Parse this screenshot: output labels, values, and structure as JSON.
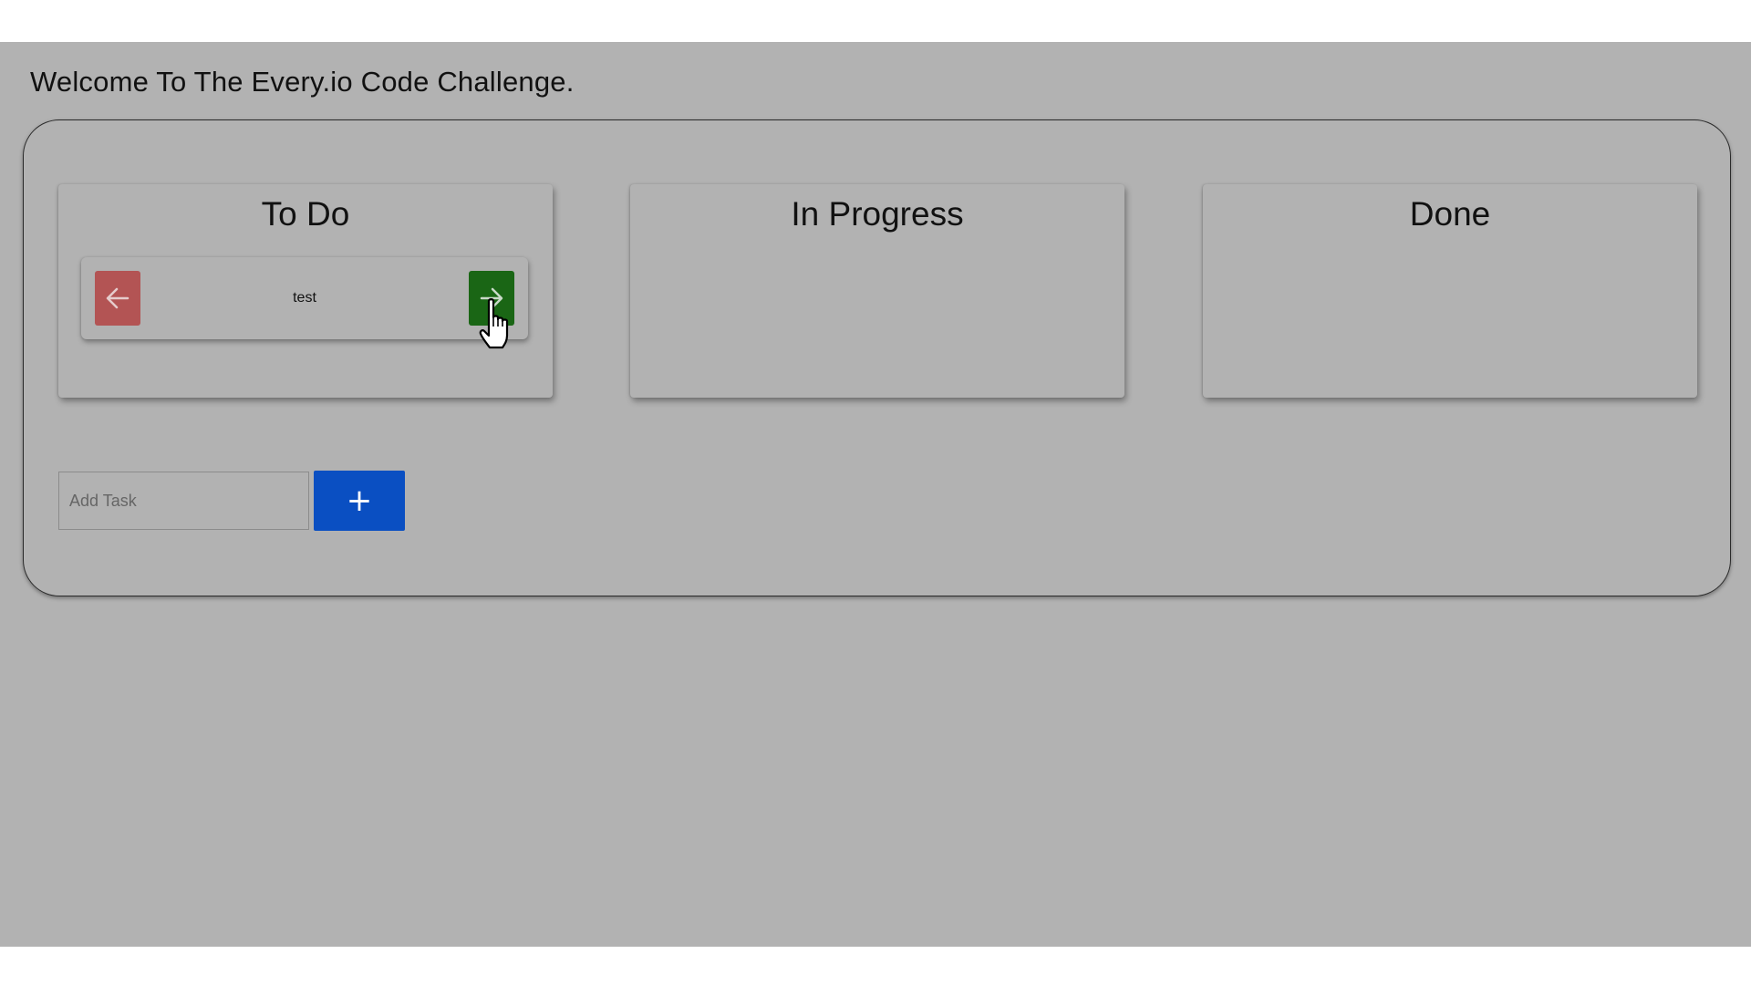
{
  "header": {
    "title": "Welcome To The Every.io Code Challenge."
  },
  "columns": [
    {
      "title": "To Do",
      "tasks": [
        {
          "text": "test",
          "back_icon": "arrow-left-icon",
          "forward_icon": "arrow-right-icon"
        }
      ]
    },
    {
      "title": "In Progress",
      "tasks": []
    },
    {
      "title": "Done",
      "tasks": []
    }
  ],
  "add_task": {
    "placeholder": "Add Task",
    "value": "",
    "button_label": "+"
  },
  "colors": {
    "background": "#b2b2b2",
    "back_button": "#b35454",
    "forward_button": "#1a6615",
    "add_button": "#0a4fc2"
  }
}
